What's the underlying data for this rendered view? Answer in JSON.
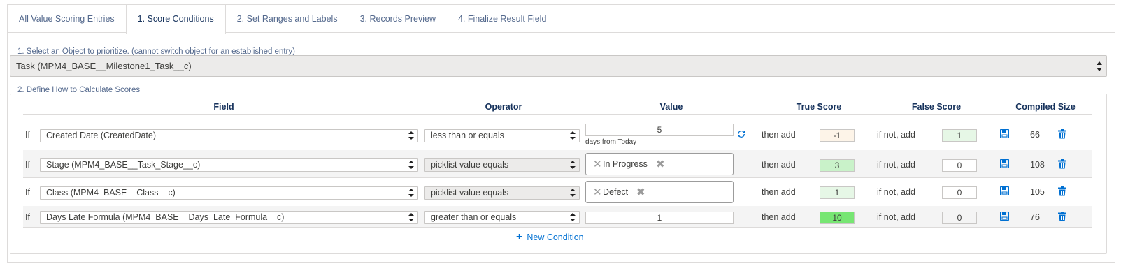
{
  "tabs": [
    {
      "label": "All Value Scoring Entries"
    },
    {
      "label": "1. Score Conditions"
    },
    {
      "label": "2. Set Ranges and Labels"
    },
    {
      "label": "3. Records Preview"
    },
    {
      "label": "4. Finalize Result Field"
    }
  ],
  "active_tab": "1. Score Conditions",
  "step1": {
    "label": "1. Select an Object to prioritize. (cannot switch object for an established entry)",
    "selected_object": "Task (MPM4_BASE__Milestone1_Task__c)"
  },
  "step2": {
    "label": "2. Define How to Calculate Scores"
  },
  "columns": {
    "field": "Field",
    "operator": "Operator",
    "value": "Value",
    "true_score": "True Score",
    "false_score": "False Score",
    "compiled_size": "Compiled Size"
  },
  "rows": [
    {
      "if": "If",
      "field": "Created Date (CreatedDate)",
      "operator": "less than or equals",
      "value": "5",
      "value_note": "days from Today",
      "then": "then add",
      "true_score": "-1",
      "else": "if not, add",
      "false_score": "1",
      "compiled_size": "66"
    },
    {
      "if": "If",
      "field": "Stage (MPM4_BASE__Task_Stage__c)",
      "operator": "picklist value equals",
      "value": "In Progress",
      "then": "then add",
      "true_score": "3",
      "else": "if not, add",
      "false_score": "0",
      "compiled_size": "108"
    },
    {
      "if": "If",
      "field": "Class (MPM4  BASE    Class    c)",
      "operator": "picklist value equals",
      "value": "Defect",
      "then": "then add",
      "true_score": "1",
      "else": "if not, add",
      "false_score": "0",
      "compiled_size": "105"
    },
    {
      "if": "If",
      "field": "Days Late Formula (MPM4  BASE    Days  Late  Formula    c)",
      "operator": "greater than or equals",
      "value": "1",
      "then": "then add",
      "true_score": "10",
      "else": "if not, add",
      "false_score": "0",
      "compiled_size": "76"
    }
  ],
  "new_condition_label": "New Condition",
  "colors": {
    "accent": "#0070d2",
    "header_text": "#16325c",
    "score_negative_bg": "#fdf4e8",
    "score_light_green_bg": "#e6f7e6",
    "score_mid_green_bg": "#c9f2c9",
    "score_bright_green_bg": "#77e673"
  },
  "icons": {
    "refresh": "refresh-icon",
    "save": "save-icon",
    "delete": "trash-icon",
    "add": "plus-icon",
    "remove_pill": "close-icon"
  }
}
